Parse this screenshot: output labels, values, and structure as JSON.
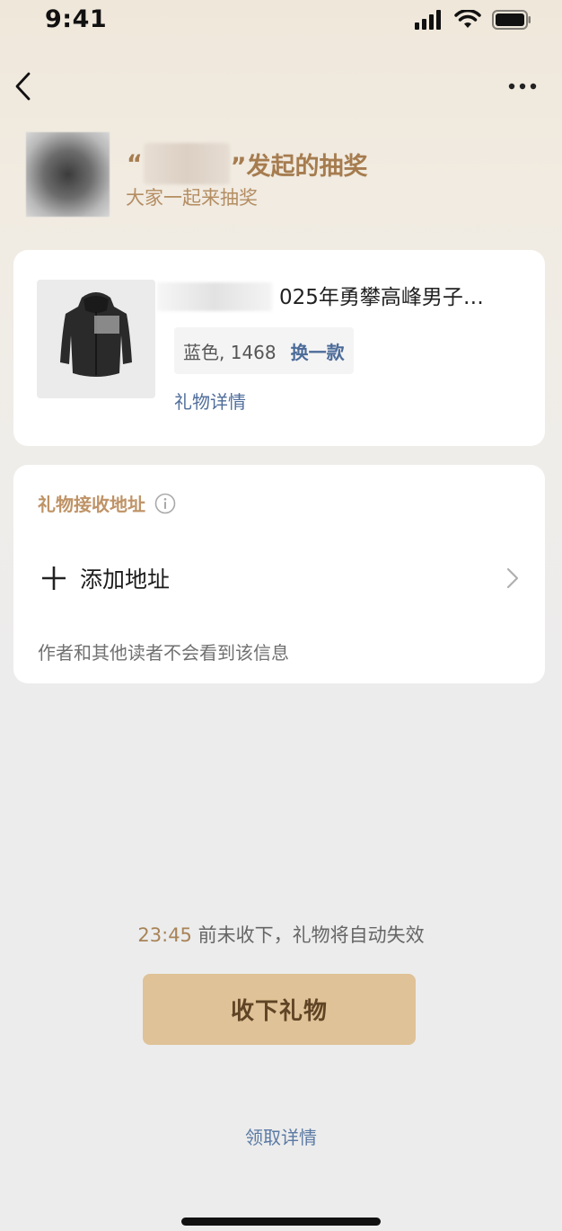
{
  "status_bar": {
    "time": "9:41"
  },
  "nav": {
    "back_icon": "chevron-left-icon",
    "more_icon": "more-horizontal-icon"
  },
  "header": {
    "quote_open": "“",
    "title_suffix": "”发起的抽奖",
    "subtitle": "大家一起来抽奖"
  },
  "gift": {
    "name": "025年勇攀高峰男子…",
    "variant": "蓝色, 1468",
    "change_label": "换一款",
    "detail_link": "礼物详情"
  },
  "address": {
    "title": "礼物接收地址",
    "info_icon": "info-circle-icon",
    "add_label": "添加地址",
    "privacy_note": "作者和其他读者不会看到该信息"
  },
  "footer": {
    "countdown_time": "23:45",
    "countdown_text": " 前未收下，礼物将自动失效",
    "accept_button": "收下礼物",
    "claim_details_link": "领取详情"
  },
  "colors": {
    "accent_gold": "#a67c4f",
    "button_bg": "#dfc297",
    "link_blue": "#4f6d9b"
  }
}
